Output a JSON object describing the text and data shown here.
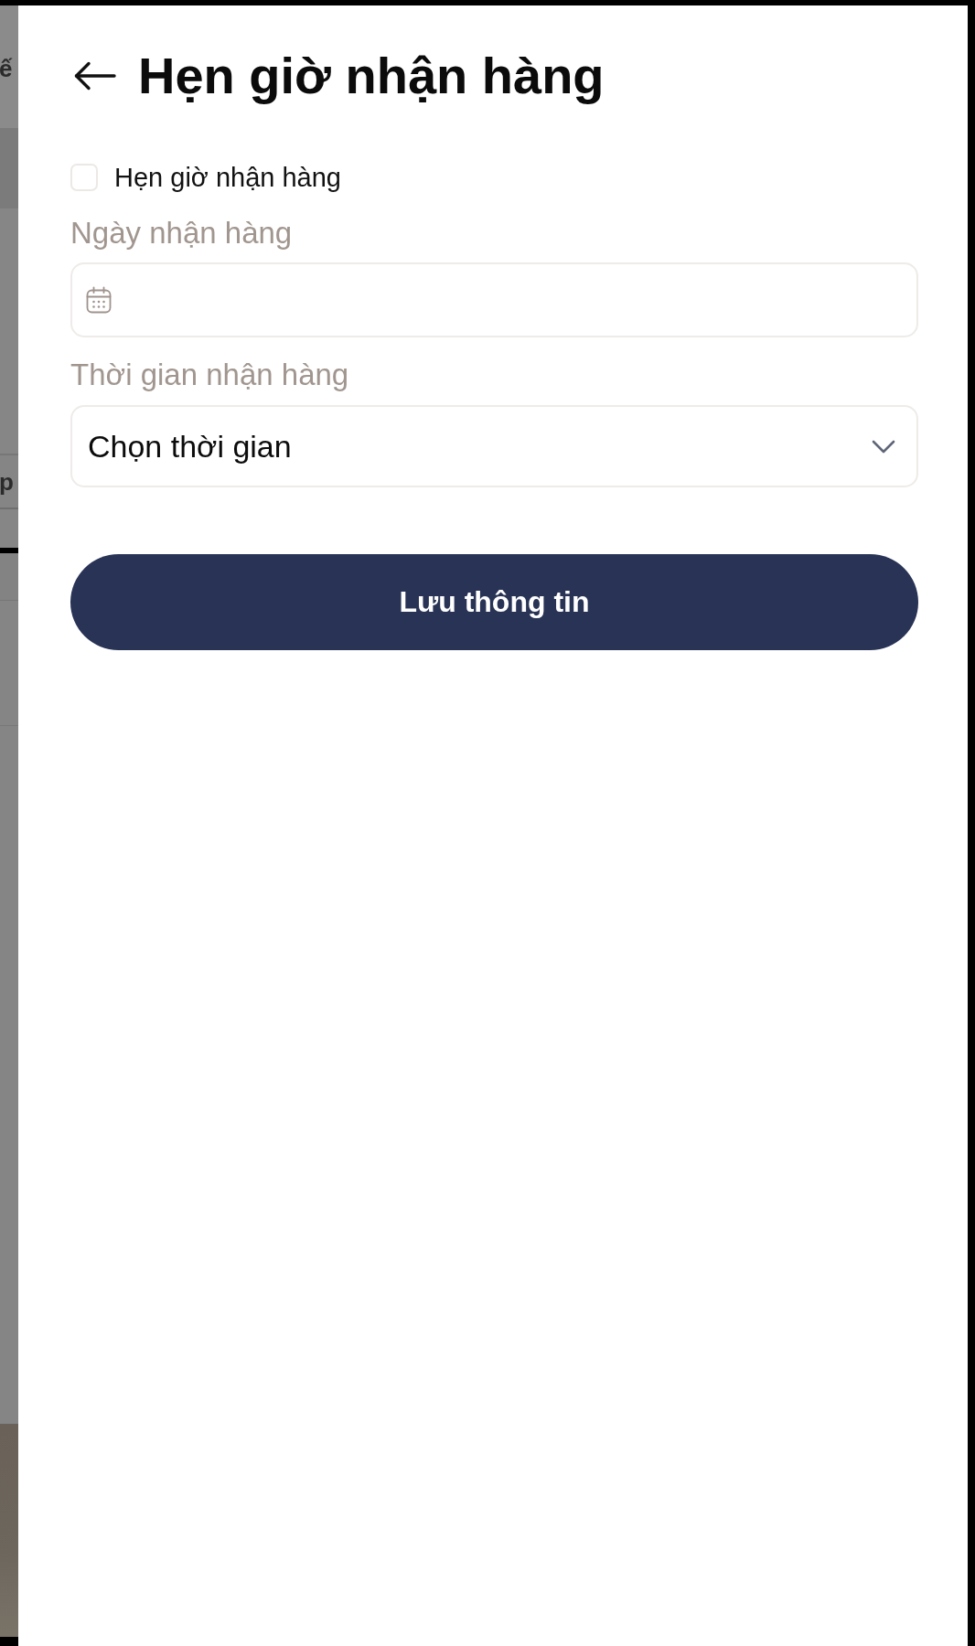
{
  "background_page": {
    "texts": [
      "ế",
      "p"
    ]
  },
  "sheet": {
    "title": "Hẹn giờ nhận hàng",
    "schedule_toggle": {
      "label": "Hẹn giờ nhận hàng",
      "checked": false
    },
    "fields": [
      {
        "kind": "date",
        "label": "Ngày nhận hàng"
      },
      {
        "kind": "select",
        "label": "Thời gian nhận hàng",
        "value": "Chọn thời gian"
      }
    ],
    "save_button": {
      "label": "Lưu thông tin"
    }
  }
}
